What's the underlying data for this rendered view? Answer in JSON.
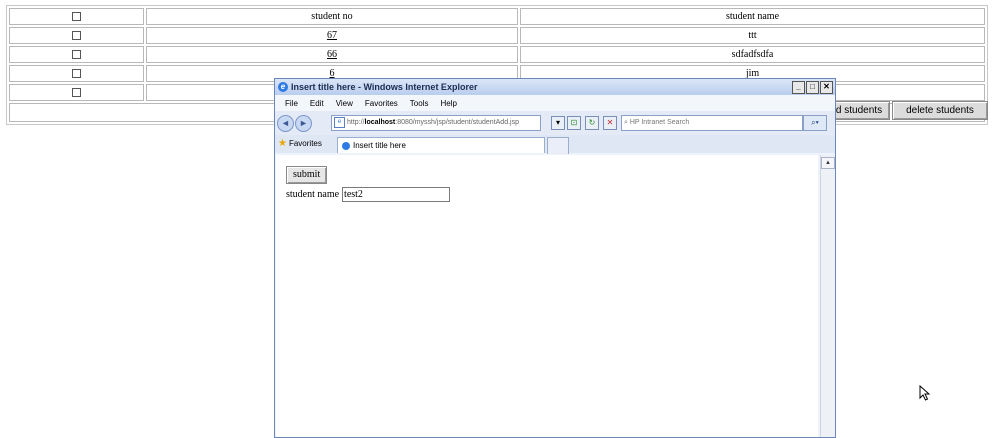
{
  "table": {
    "headers": [
      "student no",
      "student name"
    ],
    "rows": [
      {
        "no": "67",
        "name": "ttt"
      },
      {
        "no": "66",
        "name": "sdfadfsdfa"
      },
      {
        "no": "6",
        "name": "jim"
      },
      {
        "no": "",
        "name": ""
      }
    ]
  },
  "buttons": {
    "add_students": "d students",
    "delete_students": "delete students"
  },
  "ie": {
    "title": "Insert title here - Windows Internet Explorer",
    "menu": [
      "File",
      "Edit",
      "View",
      "Favorites",
      "Tools",
      "Help"
    ],
    "address_prefix": "http://",
    "address_host": "localhost",
    "address_rest": ":8080/myssh/jsp/student/studentAdd.jsp",
    "search_placeholder": "HP Intranet Search",
    "favorites_label": "Favorites",
    "tab_title": "Insert title here"
  },
  "form": {
    "submit_label": "submit",
    "field_label": "student name",
    "field_value": "test2"
  }
}
